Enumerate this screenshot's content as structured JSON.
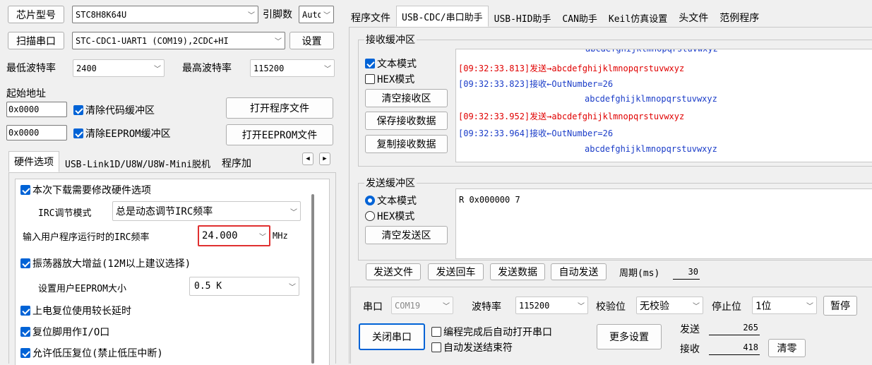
{
  "left": {
    "chip_btn": "芯片型号",
    "chip_value": "STC8H8K64U",
    "pins_label": "引脚数",
    "pins_value": "Auto",
    "scan_btn": "扫描串口",
    "port_value": "STC-CDC1-UART1 (COM19),2CDC+HI",
    "settings_btn": "设置",
    "min_baud_label": "最低波特率",
    "min_baud_value": "2400",
    "max_baud_label": "最高波特率",
    "max_baud_value": "115200",
    "start_addr_label": "起始地址",
    "addr1_value": "0x0000",
    "clear_code_label": "清除代码缓冲区",
    "open_prog_btn": "打开程序文件",
    "addr2_value": "0x0000",
    "clear_eeprom_label": "清除EEPROM缓冲区",
    "open_eeprom_btn": "打开EEPROM文件",
    "tabs": [
      "硬件选项",
      "USB-Link1D/U8W/U8W-Mini脱机",
      "程序加"
    ],
    "hw": {
      "modify_label": "本次下载需要修改硬件选项",
      "irc_mode_label": "IRC调节模式",
      "irc_mode_value": "总是动态调节IRC频率",
      "irc_freq_label": "输入用户程序运行时的IRC频率",
      "irc_freq_value": "24.000",
      "irc_freq_unit": "MHz",
      "osc_gain_label": "振荡器放大增益(12M以上建议选择)",
      "eeprom_size_label": "设置用户EEPROM大小",
      "eeprom_size_value": "0.5 K",
      "reset_delay_label": "上电复位使用较长延时",
      "reset_pin_label": "复位脚用作I/O口",
      "lvr_label": "允许低压复位(禁止低压中断)"
    }
  },
  "right": {
    "tabs": [
      "程序文件",
      "USB-CDC/串口助手",
      "USB-HID助手",
      "CAN助手",
      "Keil仿真设置",
      "头文件",
      "范例程序"
    ],
    "recv": {
      "title": "接收缓冲区",
      "text_mode": "文本模式",
      "hex_mode": "HEX模式",
      "clear_btn": "清空接收区",
      "save_btn": "保存接收数据",
      "copy_btn": "复制接收数据",
      "lines": [
        {
          "prefix": "[09:32:33.813]发送→",
          "text": "abcdefghijklmnopqrstuvwxyz",
          "color": "#e00000"
        },
        {
          "prefix": "[09:32:33.823]接收←",
          "text": "OutNumber=26",
          "color": "#1a3cc8"
        },
        {
          "prefix": "",
          "text": "abcdefghijklmnopqrstuvwxyz",
          "color": "#1a3cc8"
        },
        {
          "prefix": "[09:32:33.952]发送→",
          "text": "abcdefghijklmnopqrstuvwxyz",
          "color": "#e00000"
        },
        {
          "prefix": "[09:32:33.964]接收←",
          "text": "OutNumber=26",
          "color": "#1a3cc8"
        },
        {
          "prefix": "",
          "text": "abcdefghijklmnopqrstuvwxyz",
          "color": "#1a3cc8"
        }
      ]
    },
    "send": {
      "title": "发送缓冲区",
      "text_mode": "文本模式",
      "hex_mode": "HEX模式",
      "clear_btn": "清空发送区",
      "content": "R 0x000000 7",
      "send_file_btn": "发送文件",
      "send_enter_btn": "发送回车",
      "send_data_btn": "发送数据",
      "auto_send_btn": "自动发送",
      "period_label": "周期(ms)",
      "period_value": "30"
    },
    "port": {
      "port_label": "串口",
      "port_value": "COM19",
      "baud_label": "波特率",
      "baud_value": "115200",
      "parity_label": "校验位",
      "parity_value": "无校验",
      "stop_label": "停止位",
      "stop_value": "1位",
      "pause_btn": "暂停",
      "close_btn": "关闭串口",
      "auto_open_label": "编程完成后自动打开串口",
      "auto_end_label": "自动发送结束符",
      "more_btn": "更多设置",
      "sent_label": "发送",
      "sent_value": "265",
      "recv_label": "接收",
      "recv_value": "418",
      "clear_btn": "清零"
    }
  }
}
